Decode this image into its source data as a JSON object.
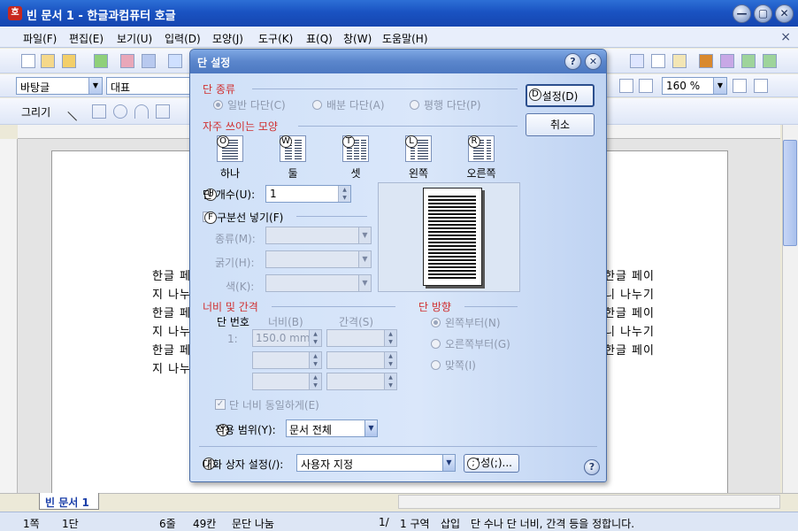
{
  "window": {
    "title": "빈 문서 1 - 한글과컴퓨터 호글",
    "logo": "호",
    "min": "—",
    "max": "▢",
    "close": "✕"
  },
  "menu": [
    "파일(F)",
    "편집(E)",
    "보기(U)",
    "입력(D)",
    "모양(J)",
    "도구(K)",
    "표(Q)",
    "창(W)",
    "도움말(H)"
  ],
  "menu_close": "×",
  "toolbar": {
    "style_combo": "바탕글",
    "font_combo": "대표",
    "zoom_combo": "160 %",
    "draw_label": "그리기"
  },
  "document": {
    "lines_left": [
      "한글 페",
      "지 나누",
      "한글 페",
      "지 나누",
      "한글 페",
      "지 나누"
    ],
    "lines_right": [
      "한글 페이",
      "니 나누기",
      "한글 페이",
      "니 나누기",
      "한글 페이"
    ]
  },
  "tab": {
    "name": "빈 문서 1"
  },
  "status": {
    "page": "1쪽",
    "column": "1단",
    "line": "6줄",
    "char": "49칸",
    "kind": "문단 나눔",
    "section": "1/",
    "section2": "1 구역",
    "mode": "삽입",
    "message": "단 수나 단 너비, 간격 등을 정합니다."
  },
  "dialog": {
    "title": "단 설정",
    "help": "?",
    "close": "✕",
    "type_group": "단 종류",
    "type_normal": "일반 다단(C)",
    "type_distrib": "배분 다단(A)",
    "type_parallel": "평행 다단(P)",
    "preset_group": "자주 쓰이는 모양",
    "presets": [
      {
        "key": "O",
        "label": "하나"
      },
      {
        "key": "W",
        "label": "둘"
      },
      {
        "key": "T",
        "label": "셋"
      },
      {
        "key": "L",
        "label": "왼쪽"
      },
      {
        "key": "R",
        "label": "오른쪽"
      }
    ],
    "col_count_label": "단 개수(U):",
    "col_count_value": "1",
    "divider_label": "구분선 넣기(F)",
    "kind_label": "종류(M):",
    "thick_label": "굵기(H):",
    "color_label": "색(K):",
    "width_group": "너비 및 간격",
    "col_no_header": "단 번호",
    "width_header": "너비(B)",
    "gap_header": "간격(S)",
    "row1_no": "1:",
    "row1_width": "150.0 mm",
    "same_width_label": "단 너비 동일하게(E)",
    "direction_group": "단 방향",
    "dir_left": "왼쪽부터(N)",
    "dir_right": "오른쪽부터(G)",
    "dir_both": "맞쪽(I)",
    "apply_label": "적용 범위(Y):",
    "apply_value": "문서 전체",
    "dlgbox_label": "대화 상자 설정(/):",
    "dlgbox_value": "사용자 지정",
    "compose_btn": "구성(;)...",
    "set_btn": "설정(D)",
    "cancel_btn": "취소",
    "hotkeys": {
      "set": "D",
      "count": "U",
      "divider": "F",
      "apply": "Y",
      "dlgbox": "/",
      "compose": ";"
    }
  }
}
